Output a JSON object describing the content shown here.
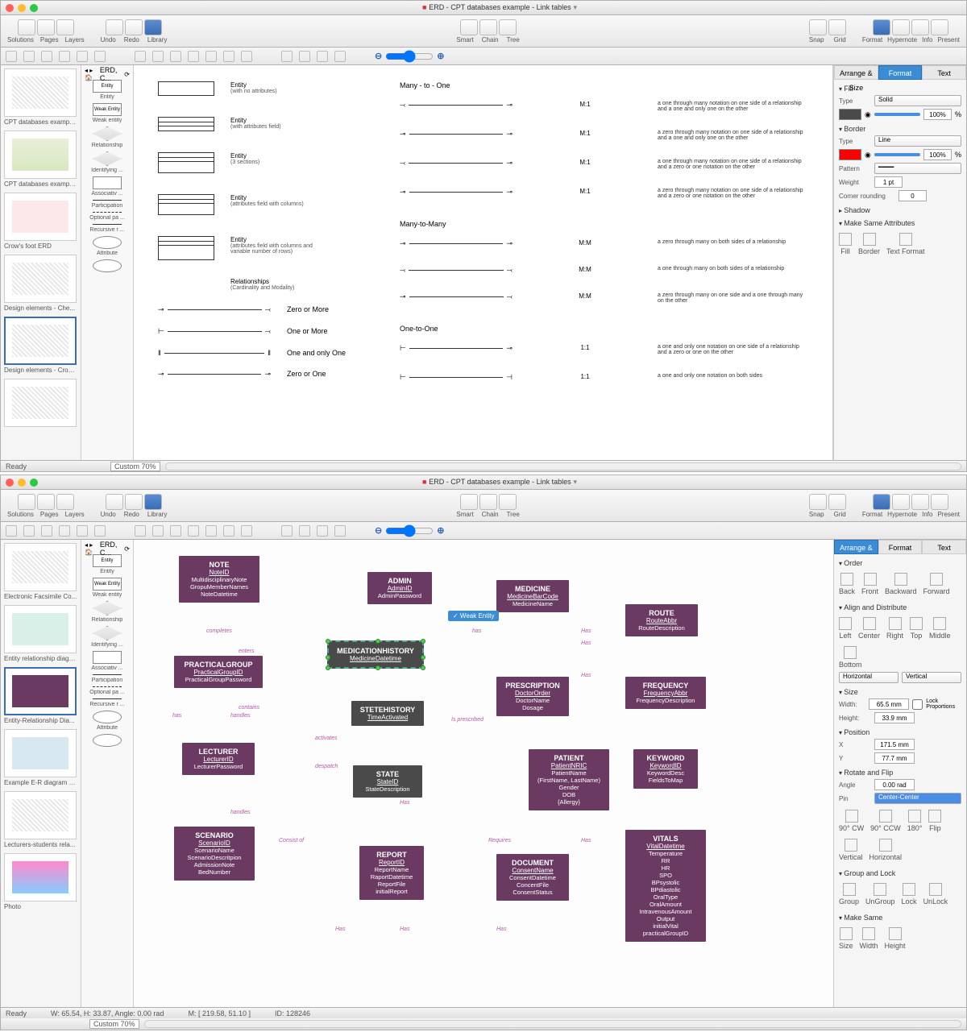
{
  "app1": {
    "title": "ERD - CPT databases example - Link tables",
    "toolbar": {
      "solutions": "Solutions",
      "pages": "Pages",
      "layers": "Layers",
      "undo": "Undo",
      "redo": "Redo",
      "library": "Library",
      "smart": "Smart",
      "chain": "Chain",
      "tree": "Tree",
      "snap": "Snap",
      "grid": "Grid",
      "format": "Format",
      "hypernote": "Hypernote",
      "info": "Info",
      "present": "Present"
    },
    "breadcrumb": "ERD, C...",
    "thumbs": [
      "CPT databases example ...",
      "CPT databases example...",
      "Crow's foot ERD",
      "Design elements - Che...",
      "Design elements - Crow..."
    ],
    "lib": [
      "Entity",
      "Weak entity",
      "Relationship",
      "Identifying ...",
      "Associativ ...",
      "Participation",
      "Optional pa ...",
      "Recursive r ...",
      "Attribute"
    ],
    "libshapes": [
      "Entity",
      "Weak Entity",
      "Relationship",
      "Relationship",
      "Associative Entity",
      "",
      "",
      "",
      "Attribute"
    ],
    "legend_entities": [
      {
        "t": "Entity",
        "s": "(with no attributes)"
      },
      {
        "t": "Entity",
        "s": "(with attributes field)"
      },
      {
        "t": "Entity",
        "s": "(3 sections)"
      },
      {
        "t": "Entity",
        "s": "(attributes field with columns)"
      },
      {
        "t": "Entity",
        "s": "(attributes field with columns and variable number of rows)"
      }
    ],
    "rel_header": {
      "t": "Relationships",
      "s": "(Cardinality and Modality)"
    },
    "cardinality": [
      "Zero or More",
      "One or More",
      "One and only One",
      "Zero or One"
    ],
    "many_to_one": "Many - to - One",
    "m1": [
      {
        "lbl": "M:1",
        "d": "a one through many notation on one side of a relationship and a one and only one on the other"
      },
      {
        "lbl": "M:1",
        "d": "a zero through many notation on one side of a relationship and a one and only one on the other"
      },
      {
        "lbl": "M:1",
        "d": "a one through many notation on one side of a relationship and a zero or one notation on the other"
      },
      {
        "lbl": "M:1",
        "d": "a zero through many notation on one side of a relationship and a zero or one notation on the other"
      }
    ],
    "many_to_many": "Many-to-Many",
    "mm": [
      {
        "lbl": "M:M",
        "d": "a zero through many on both sides of a relationship"
      },
      {
        "lbl": "M:M",
        "d": "a one through many on both sides of a relationship"
      },
      {
        "lbl": "M:M",
        "d": "a zero through many on one side and a one through many on the other"
      }
    ],
    "one_to_one": "One-to-One",
    "oo": [
      {
        "lbl": "1:1",
        "d": "a one and only one notation on one side of a relationship and a zero or one on the other"
      },
      {
        "lbl": "1:1",
        "d": "a one and only one notation on both sides"
      }
    ],
    "zoom": "Custom 70%",
    "status": "Ready",
    "format_panel": {
      "tabs": [
        "Arrange & Size",
        "Format",
        "Text"
      ],
      "fill": "Fill",
      "type": "Type",
      "solid": "Solid",
      "pct": "100%",
      "border": "Border",
      "line": "Line",
      "pattern": "Pattern",
      "weight": "Weight",
      "weight_val": "1 pt",
      "corner": "Corner rounding",
      "corner_val": "0",
      "shadow": "Shadow",
      "make_same": "Make Same Attributes",
      "same_items": [
        "Fill",
        "Border",
        "Text Format"
      ]
    }
  },
  "app2": {
    "title": "ERD - CPT databases example - Link tables",
    "thumbs": [
      "Electronic Facsimile Co...",
      "Entity relationship diagram",
      "Entity-Relationship Dia...",
      "Example E-R diagram e...",
      "Lecturers-students rela...",
      "Photo"
    ],
    "tooltip": "✓ Weak Entity",
    "entities": {
      "note": {
        "n": "NOTE",
        "k": "NoteID",
        "f": [
          "MultidisciplinaryNote",
          "GropuMemberNames",
          "NoteDatetime"
        ]
      },
      "admin": {
        "n": "ADMIN",
        "k": "AdminID",
        "f": [
          "AdminPassword"
        ]
      },
      "medicine": {
        "n": "MEDICINE",
        "k": "MedicineBarCode",
        "f": [
          "MedicineName"
        ]
      },
      "route": {
        "n": "ROUTE",
        "k": "RouteAbbr",
        "f": [
          "RouteDescription"
        ]
      },
      "practicalgroup": {
        "n": "PRACTICALGROUP",
        "k": "PracticalGroupID",
        "f": [
          "PracticalGroupPassword"
        ]
      },
      "medicationhistory": {
        "n": "MEDICATIONHISTORY",
        "k": "MedicineDatetime",
        "f": []
      },
      "prescription": {
        "n": "PRESCRIPTION",
        "k": "DoctorOrder",
        "f": [
          "DoctorName",
          "Dosage"
        ]
      },
      "frequency": {
        "n": "FREQUENCY",
        "k": "FrequencyAbbr",
        "f": [
          "FrequencyDescription"
        ]
      },
      "lecturer": {
        "n": "LECTURER",
        "k": "LecturerID",
        "f": [
          "LecturerPassword"
        ]
      },
      "stetehistory": {
        "n": "STETEHISTORY",
        "k": "TimeActivated",
        "f": []
      },
      "state": {
        "n": "STATE",
        "k": "StateID",
        "f": [
          "StateDescription"
        ]
      },
      "patient": {
        "n": "PATIENT",
        "k": "PatientNRIC",
        "f": [
          "PatientName (FirstName, LastName)",
          "Gender",
          "DOB",
          "{Allergy}"
        ]
      },
      "keyword": {
        "n": "KEYWORD",
        "k": "KeywordID",
        "f": [
          "KeywordDesc",
          "FieldsToMap"
        ]
      },
      "scenario": {
        "n": "SCENARIO",
        "k": "ScenarioID",
        "f": [
          "ScenarioName",
          "ScenarioDescritpion",
          "AdmissionNote",
          "BedNumber"
        ]
      },
      "report": {
        "n": "REPORT",
        "k": "ReportID",
        "f": [
          "ReportName",
          "RaportDatetime",
          "ReportFile",
          "initialReport"
        ]
      },
      "document": {
        "n": "DOCUMENT",
        "k": "ConsentName",
        "f": [
          "ConsentDatetime",
          "ConcentFile",
          "ConsentStatus"
        ]
      },
      "vitals": {
        "n": "VITALS",
        "k": "VitalDatetime",
        "f": [
          "Temperature",
          "RR",
          "HR",
          "SPO",
          "BPsystolic",
          "BPdiastolic",
          "OralType",
          "OralAmount",
          "IntravenousAmount",
          "Output",
          "initialVital",
          "practicalGroupID"
        ]
      }
    },
    "rels": [
      "completes",
      "enters",
      "has",
      "Has",
      "handles",
      "contains",
      "activates",
      "despatch",
      "Is prescribed",
      "handles",
      "Consist of",
      "Has",
      "Requires",
      "Has",
      "Has",
      "Has",
      "Has"
    ],
    "zoom": "Custom 70%",
    "status": "Ready",
    "status_coords": "W: 65.54,  H: 33.87,  Angle: 0.00 rad",
    "status_mouse": "M: [ 219.58, 51.10 ]",
    "status_id": "ID: 128246",
    "arrange_panel": {
      "tabs": [
        "Arrange & Size",
        "Format",
        "Text"
      ],
      "order": "Order",
      "order_items": [
        "Back",
        "Front",
        "Backward",
        "Forward"
      ],
      "align": "Align and Distribute",
      "align_items": [
        "Left",
        "Center",
        "Right",
        "Top",
        "Middle",
        "Bottom"
      ],
      "horiz": "Horizontal",
      "vert": "Vertical",
      "size": "Size",
      "width": "Width:",
      "width_v": "65.5 mm",
      "height": "Height:",
      "height_v": "33.9 mm",
      "lock": "Lock Proportions",
      "position": "Position",
      "x": "X",
      "x_v": "171.5 mm",
      "y": "Y",
      "y_v": "77.7 mm",
      "rotate": "Rotate and Flip",
      "angle": "Angle",
      "angle_v": "0.00 rad",
      "pin": "Pin",
      "pin_v": "Center-Center",
      "rot_items": [
        "90° CW",
        "90° CCW",
        "180°",
        "Flip",
        "Vertical",
        "Horizontal"
      ],
      "group": "Group and Lock",
      "group_items": [
        "Group",
        "UnGroup",
        "Lock",
        "UnLock"
      ],
      "make_same": "Make Same",
      "same_items": [
        "Size",
        "Width",
        "Height"
      ]
    }
  }
}
